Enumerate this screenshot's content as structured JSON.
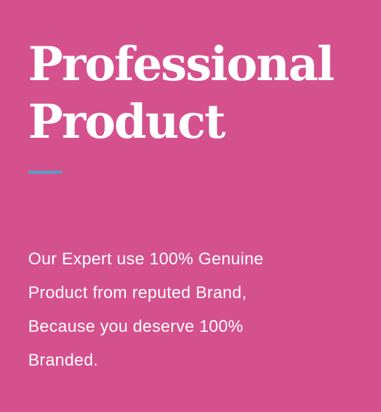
{
  "heading": {
    "line1": "Professional",
    "line2": "Product"
  },
  "description": {
    "line1": "Our Expert use 100% Genuine",
    "line2": "Product from reputed Brand,",
    "line3": "Because you deserve 100%",
    "line4": "Branded."
  },
  "colors": {
    "background": "#d5518d",
    "accent": "#4fa3c7",
    "text": "#ffffff"
  }
}
